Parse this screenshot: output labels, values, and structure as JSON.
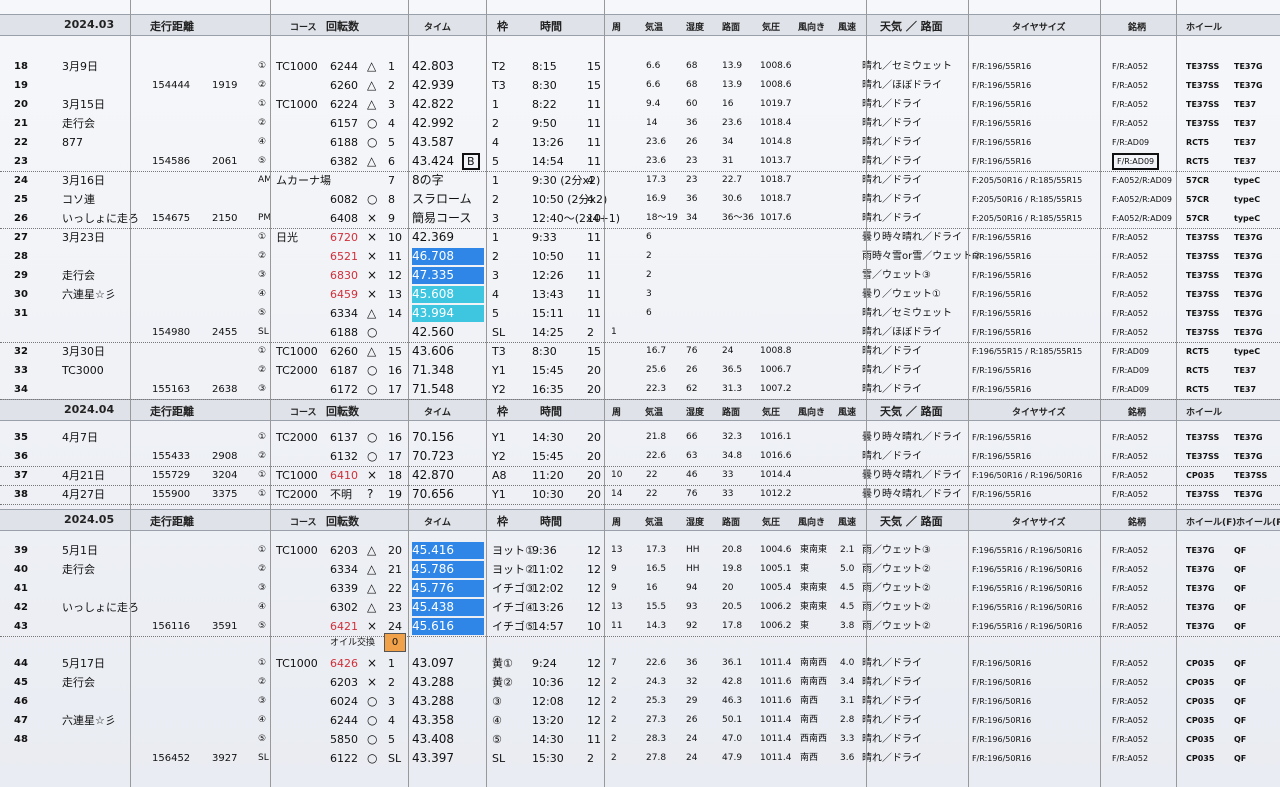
{
  "headers": [
    {
      "label": "2024.03",
      "km": "走行距離",
      "course": "コース",
      "rpm": "回転数",
      "time": "タイム",
      "frame": "枠",
      "hour": "時間",
      "lap": "周",
      "temp": "気温",
      "hum": "湿度",
      "road": "路面",
      "press": "気圧",
      "wdir": "風向き",
      "wspd": "風速",
      "weather": "天気 ／ 路面",
      "tire": "タイヤサイズ",
      "brand": "銘柄",
      "wheel": "ホイール",
      "wheel2": ""
    },
    {
      "label": "2024.04",
      "km": "走行距離",
      "course": "コース",
      "rpm": "回転数",
      "time": "タイム",
      "frame": "枠",
      "hour": "時間",
      "lap": "周",
      "temp": "気温",
      "hum": "湿度",
      "road": "路面",
      "press": "気圧",
      "wdir": "風向き",
      "wspd": "風速",
      "weather": "天気 ／ 路面",
      "tire": "タイヤサイズ",
      "brand": "銘柄",
      "wheel": "ホイール",
      "wheel2": ""
    },
    {
      "label": "2024.05",
      "km": "走行距離",
      "course": "コース",
      "rpm": "回転数",
      "time": "タイム",
      "frame": "枠",
      "hour": "時間",
      "lap": "周",
      "temp": "気温",
      "hum": "湿度",
      "road": "路面",
      "press": "気圧",
      "wdir": "風向き",
      "wspd": "風速",
      "weather": "天気 ／ 路面",
      "tire": "タイヤサイズ",
      "brand": "銘柄",
      "wheel": "ホイール(F)",
      "wheel2": "ホイール(R)"
    }
  ],
  "rows": [
    {
      "idx": "18",
      "date": "3月9日",
      "km": "",
      "d2": "",
      "n": "①",
      "cs": "TC1000",
      "rpm": "6244",
      "mk": "△",
      "lap": "1",
      "tm": "42.803",
      "fr": "T2",
      "hr": "8:15",
      "sh": "15",
      "lp": "",
      "tp": "6.6",
      "hm": "68",
      "rs": "13.9",
      "pr": "1008.6",
      "wd": "",
      "ws": "",
      "wx": "晴れ／セミウェット",
      "ty": "F/R:196/55R16",
      "br": "F/R:A052",
      "w1": "TE37SS",
      "w2": "TE37G"
    },
    {
      "idx": "19",
      "date": "",
      "km": "154444",
      "d2": "1919",
      "n": "②",
      "cs": "",
      "rpm": "6260",
      "mk": "△",
      "lap": "2",
      "tm": "42.939",
      "fr": "T3",
      "hr": "8:30",
      "sh": "15",
      "lp": "",
      "tp": "6.6",
      "hm": "68",
      "rs": "13.9",
      "pr": "1008.6",
      "wd": "",
      "ws": "",
      "wx": "晴れ／ほぼドライ",
      "ty": "F/R:196/55R16",
      "br": "F/R:A052",
      "w1": "TE37SS",
      "w2": "TE37G"
    },
    {
      "idx": "20",
      "date": "3月15日",
      "km": "",
      "d2": "",
      "n": "①",
      "cs": "TC1000",
      "rpm": "6224",
      "mk": "△",
      "lap": "3",
      "tm": "42.822",
      "fr": "1",
      "hr": "8:22",
      "sh": "11",
      "lp": "",
      "tp": "9.4",
      "hm": "60",
      "rs": "16",
      "pr": "1019.7",
      "wd": "",
      "ws": "",
      "wx": "晴れ／ドライ",
      "ty": "F/R:196/55R16",
      "br": "F/R:A052",
      "w1": "TE37SS",
      "w2": "TE37"
    },
    {
      "idx": "21",
      "date": "走行会",
      "km": "",
      "d2": "",
      "n": "②",
      "cs": "",
      "rpm": "6157",
      "mk": "○",
      "lap": "4",
      "tm": "42.992",
      "fr": "2",
      "hr": "9:50",
      "sh": "11",
      "lp": "",
      "tp": "14",
      "hm": "36",
      "rs": "23.6",
      "pr": "1018.4",
      "wd": "",
      "ws": "",
      "wx": "晴れ／ドライ",
      "ty": "F/R:196/55R16",
      "br": "F/R:A052",
      "w1": "TE37SS",
      "w2": "TE37"
    },
    {
      "idx": "22",
      "date": "877",
      "km": "",
      "d2": "",
      "n": "④",
      "cs": "",
      "rpm": "6188",
      "mk": "○",
      "lap": "5",
      "tm": "43.587",
      "fr": "4",
      "hr": "13:26",
      "sh": "11",
      "lp": "",
      "tp": "23.6",
      "hm": "26",
      "rs": "34",
      "pr": "1014.8",
      "wd": "",
      "ws": "",
      "wx": "晴れ／ドライ",
      "ty": "F/R:196/55R16",
      "br": "F/R:AD09",
      "w1": "RCT5",
      "w2": "TE37"
    },
    {
      "idx": "23",
      "date": "",
      "km": "154586",
      "d2": "2061",
      "n": "⑤",
      "cs": "",
      "rpm": "6382",
      "mk": "△",
      "lap": "6",
      "tm": "43.424",
      "fr": "5",
      "hr": "14:54",
      "sh": "11",
      "lp": "",
      "tp": "23.6",
      "hm": "23",
      "rs": "31",
      "pr": "1013.7",
      "wd": "",
      "ws": "",
      "wx": "晴れ／ドライ",
      "ty": "F/R:196/55R16",
      "br": "F/R:AD09",
      "w1": "RCT5",
      "w2": "TE37",
      "flagB": "B",
      "boxBrand": true
    },
    {
      "idx": "24",
      "date": "3月16日",
      "km": "",
      "d2": "",
      "n": "AM",
      "cs": "ムカーナ場",
      "rpm": "",
      "mk": "",
      "lap": "7",
      "tm": "8の字",
      "fr": "1",
      "hr": "9:30 (2分x2)",
      "sh": "4",
      "lp": "",
      "tp": "17.3",
      "hm": "23",
      "rs": "22.7",
      "pr": "1018.7",
      "wd": "",
      "ws": "",
      "wx": "晴れ／ドライ",
      "ty": "F:205/50R16 / R:185/55R15",
      "br": "F:A052/R:AD09",
      "w1": "57CR",
      "w2": "typeC"
    },
    {
      "idx": "25",
      "date": "コソ連",
      "km": "",
      "d2": "",
      "n": "",
      "cs": "",
      "rpm": "6082",
      "mk": "○",
      "lap": "8",
      "tm": "スラローム",
      "fr": "2",
      "hr": "10:50 (2分x2)",
      "sh": "4",
      "lp": "",
      "tp": "16.9",
      "hm": "36",
      "rs": "30.6",
      "pr": "1018.7",
      "wd": "",
      "ws": "",
      "wx": "晴れ／ドライ",
      "ty": "F:205/50R16 / R:185/55R15",
      "br": "F:A052/R:AD09",
      "w1": "57CR",
      "w2": "typeC"
    },
    {
      "idx": "26",
      "date": "いっしょに走ろ",
      "km": "154675",
      "d2": "2150",
      "n": "PM",
      "cs": "",
      "rpm": "6408",
      "mk": "×",
      "lap": "9",
      "tm": "簡易コース",
      "fr": "3",
      "hr": "12:40〜(2x4+1)",
      "sh": "10",
      "lp": "",
      "tp": "18〜19",
      "hm": "34",
      "rs": "36〜36",
      "pr": "1017.6",
      "wd": "",
      "ws": "",
      "wx": "晴れ／ドライ",
      "ty": "F:205/50R16 / R:185/55R15",
      "br": "F:A052/R:AD09",
      "w1": "57CR",
      "w2": "typeC"
    },
    {
      "idx": "27",
      "date": "3月23日",
      "km": "",
      "d2": "",
      "n": "①",
      "cs": "日光",
      "rpm": "6720",
      "red": true,
      "mk": "×",
      "lap": "10",
      "tm": "42.369",
      "fr": "1",
      "hr": "9:33",
      "sh": "11",
      "lp": "",
      "tp": "6",
      "hm": "",
      "rs": "",
      "pr": "",
      "wd": "",
      "ws": "",
      "wx": "曇り時々晴れ／ドライ",
      "ty": "F/R:196/55R16",
      "br": "F/R:A052",
      "w1": "TE37SS",
      "w2": "TE37G"
    },
    {
      "idx": "28",
      "date": "",
      "km": "",
      "d2": "",
      "n": "②",
      "cs": "",
      "rpm": "6521",
      "red": true,
      "mk": "×",
      "lap": "11",
      "tm": "46.708",
      "tmc": "blue",
      "fr": "2",
      "hr": "10:50",
      "sh": "11",
      "lp": "",
      "tp": "2",
      "hm": "",
      "rs": "",
      "pr": "",
      "wd": "",
      "ws": "",
      "wx": "雨時々雪or雪／ウェット②",
      "ty": "F/R:196/55R16",
      "br": "F/R:A052",
      "w1": "TE37SS",
      "w2": "TE37G"
    },
    {
      "idx": "29",
      "date": "走行会",
      "km": "",
      "d2": "",
      "n": "③",
      "cs": "",
      "rpm": "6830",
      "red": true,
      "mk": "×",
      "lap": "12",
      "tm": "47.335",
      "tmc": "blue",
      "fr": "3",
      "hr": "12:26",
      "sh": "11",
      "lp": "",
      "tp": "2",
      "hm": "",
      "rs": "",
      "pr": "",
      "wd": "",
      "ws": "",
      "wx": "雪／ウェット③",
      "ty": "F/R:196/55R16",
      "br": "F/R:A052",
      "w1": "TE37SS",
      "w2": "TE37G"
    },
    {
      "idx": "30",
      "date": "六連星☆彡",
      "km": "",
      "d2": "",
      "n": "④",
      "cs": "",
      "rpm": "6459",
      "red": true,
      "mk": "×",
      "lap": "13",
      "tm": "45.608",
      "tmc": "cyan",
      "fr": "4",
      "hr": "13:43",
      "sh": "11",
      "lp": "",
      "tp": "3",
      "hm": "",
      "rs": "",
      "pr": "",
      "wd": "",
      "ws": "",
      "wx": "曇り／ウェット①",
      "ty": "F/R:196/55R16",
      "br": "F/R:A052",
      "w1": "TE37SS",
      "w2": "TE37G"
    },
    {
      "idx": "31",
      "date": "",
      "km": "",
      "d2": "",
      "n": "⑤",
      "cs": "",
      "rpm": "6334",
      "mk": "△",
      "lap": "14",
      "tm": "43.994",
      "tmc": "cyan",
      "fr": "5",
      "hr": "15:11",
      "sh": "11",
      "lp": "",
      "tp": "6",
      "hm": "",
      "rs": "",
      "pr": "",
      "wd": "",
      "ws": "",
      "wx": "晴れ／セミウェット",
      "ty": "F/R:196/55R16",
      "br": "F/R:A052",
      "w1": "TE37SS",
      "w2": "TE37G"
    },
    {
      "idx": "",
      "date": "",
      "km": "154980",
      "d2": "2455",
      "n": "SL",
      "cs": "",
      "rpm": "6188",
      "mk": "○",
      "lap": "",
      "tm": "42.560",
      "fr": "SL",
      "hr": "14:25",
      "sh": "2",
      "lp": "1",
      "tp": "",
      "hm": "",
      "rs": "",
      "pr": "",
      "wd": "",
      "ws": "",
      "wx": "晴れ／ほぼドライ",
      "ty": "F/R:196/55R16",
      "br": "F/R:A052",
      "w1": "TE37SS",
      "w2": "TE37G"
    },
    {
      "idx": "32",
      "date": "3月30日",
      "km": "",
      "d2": "",
      "n": "①",
      "cs": "TC1000",
      "rpm": "6260",
      "mk": "△",
      "lap": "15",
      "tm": "43.606",
      "fr": "T3",
      "hr": "8:30",
      "sh": "15",
      "lp": "",
      "tp": "16.7",
      "hm": "76",
      "rs": "24",
      "pr": "1008.8",
      "wd": "",
      "ws": "",
      "wx": "晴れ／ドライ",
      "ty": "F:196/55R15 / R:185/55R15",
      "br": "F/R:AD09",
      "w1": "RCT5",
      "w2": "typeC"
    },
    {
      "idx": "33",
      "date": "TC3000",
      "km": "",
      "d2": "",
      "n": "②",
      "cs": "TC2000",
      "rpm": "6187",
      "mk": "○",
      "lap": "16",
      "tm": "71.348",
      "fr": "Y1",
      "hr": "15:45",
      "sh": "20",
      "lp": "",
      "tp": "25.6",
      "hm": "26",
      "rs": "36.5",
      "pr": "1006.7",
      "wd": "",
      "ws": "",
      "wx": "晴れ／ドライ",
      "ty": "F/R:196/55R16",
      "br": "F/R:AD09",
      "w1": "RCT5",
      "w2": "TE37"
    },
    {
      "idx": "34",
      "date": "",
      "km": "155163",
      "d2": "2638",
      "n": "③",
      "cs": "",
      "rpm": "6172",
      "mk": "○",
      "lap": "17",
      "tm": "71.548",
      "fr": "Y2",
      "hr": "16:35",
      "sh": "20",
      "lp": "",
      "tp": "22.3",
      "hm": "62",
      "rs": "31.3",
      "pr": "1007.2",
      "wd": "",
      "ws": "",
      "wx": "晴れ／ドライ",
      "ty": "F/R:196/55R16",
      "br": "F/R:AD09",
      "w1": "RCT5",
      "w2": "TE37"
    },
    {
      "idx": "35",
      "date": "4月7日",
      "km": "",
      "d2": "",
      "n": "①",
      "cs": "TC2000",
      "rpm": "6137",
      "mk": "○",
      "lap": "16",
      "tm": "70.156",
      "fr": "Y1",
      "hr": "14:30",
      "sh": "20",
      "lp": "",
      "tp": "21.8",
      "hm": "66",
      "rs": "32.3",
      "pr": "1016.1",
      "wd": "",
      "ws": "",
      "wx": "曇り時々晴れ／ドライ",
      "ty": "F/R:196/55R16",
      "br": "F/R:A052",
      "w1": "TE37SS",
      "w2": "TE37G"
    },
    {
      "idx": "36",
      "date": "",
      "km": "155433",
      "d2": "2908",
      "n": "②",
      "cs": "",
      "rpm": "6132",
      "mk": "○",
      "lap": "17",
      "tm": "70.723",
      "fr": "Y2",
      "hr": "15:45",
      "sh": "20",
      "lp": "",
      "tp": "22.6",
      "hm": "63",
      "rs": "34.8",
      "pr": "1016.6",
      "wd": "",
      "ws": "",
      "wx": "晴れ／ドライ",
      "ty": "F/R:196/55R16",
      "br": "F/R:A052",
      "w1": "TE37SS",
      "w2": "TE37G"
    },
    {
      "idx": "37",
      "date": "4月21日",
      "km": "155729",
      "d2": "3204",
      "n": "①",
      "cs": "TC1000",
      "rpm": "6410",
      "red": true,
      "mk": "×",
      "lap": "18",
      "tm": "42.870",
      "fr": "A8",
      "hr": "11:20",
      "sh": "20",
      "lp": "10",
      "tp": "22",
      "hm": "46",
      "rs": "33",
      "pr": "1014.4",
      "wd": "",
      "ws": "",
      "wx": "曇り時々晴れ／ドライ",
      "ty": "F:196/50R16 / R:196/50R16",
      "br": "F/R:A052",
      "w1": "CP035",
      "w2": "TE37SS"
    },
    {
      "idx": "38",
      "date": "4月27日",
      "km": "155900",
      "d2": "3375",
      "n": "①",
      "cs": "TC2000",
      "rpm": "不明",
      "mk": "?",
      "lap": "19",
      "tm": "70.656",
      "fr": "Y1",
      "hr": "10:30",
      "sh": "20",
      "lp": "14",
      "tp": "22",
      "hm": "76",
      "rs": "33",
      "pr": "1012.2",
      "wd": "",
      "ws": "",
      "wx": "曇り時々晴れ／ドライ",
      "ty": "F/R:196/55R16",
      "br": "F/R:A052",
      "w1": "TE37SS",
      "w2": "TE37G"
    },
    {
      "idx": "39",
      "date": "5月1日",
      "km": "",
      "d2": "",
      "n": "①",
      "cs": "TC1000",
      "rpm": "6203",
      "mk": "△",
      "lap": "20",
      "tm": "45.416",
      "tmc": "blue",
      "fr": "ヨット①",
      "hr": "9:36",
      "sh": "12",
      "lp": "13",
      "tp": "17.3",
      "hm": "HH",
      "rs": "20.8",
      "pr": "1004.6",
      "wd": "東南東",
      "ws": "2.1",
      "wx": "雨／ウェット③",
      "ty": "F:196/55R16 / R:196/50R16",
      "br": "F/R:A052",
      "w1": "TE37G",
      "w2": "QF"
    },
    {
      "idx": "40",
      "date": "走行会",
      "km": "",
      "d2": "",
      "n": "②",
      "cs": "",
      "rpm": "6334",
      "mk": "△",
      "lap": "21",
      "tm": "45.786",
      "tmc": "blue",
      "fr": "ヨット②",
      "hr": "11:02",
      "sh": "12",
      "lp": "9",
      "tp": "16.5",
      "hm": "HH",
      "rs": "19.8",
      "pr": "1005.1",
      "wd": "東",
      "ws": "5.0",
      "wx": "雨／ウェット②",
      "ty": "F:196/55R16 / R:196/50R16",
      "br": "F/R:A052",
      "w1": "TE37G",
      "w2": "QF"
    },
    {
      "idx": "41",
      "date": "",
      "km": "",
      "d2": "",
      "n": "③",
      "cs": "",
      "rpm": "6339",
      "mk": "△",
      "lap": "22",
      "tm": "45.776",
      "tmc": "blue",
      "fr": "イチゴ③",
      "hr": "12:02",
      "sh": "12",
      "lp": "9",
      "tp": "16",
      "hm": "94",
      "rs": "20",
      "pr": "1005.4",
      "wd": "東南東",
      "ws": "4.5",
      "wx": "雨／ウェット②",
      "ty": "F:196/55R16 / R:196/50R16",
      "br": "F/R:A052",
      "w1": "TE37G",
      "w2": "QF"
    },
    {
      "idx": "42",
      "date": "いっしょに走ろ",
      "km": "",
      "d2": "",
      "n": "④",
      "cs": "",
      "rpm": "6302",
      "mk": "△",
      "lap": "23",
      "tm": "45.438",
      "tmc": "blue",
      "fr": "イチゴ④",
      "hr": "13:26",
      "sh": "12",
      "lp": "13",
      "tp": "15.5",
      "hm": "93",
      "rs": "20.5",
      "pr": "1006.2",
      "wd": "東南東",
      "ws": "4.5",
      "wx": "雨／ウェット②",
      "ty": "F:196/55R16 / R:196/50R16",
      "br": "F/R:A052",
      "w1": "TE37G",
      "w2": "QF"
    },
    {
      "idx": "43",
      "date": "",
      "km": "156116",
      "d2": "3591",
      "n": "⑤",
      "cs": "",
      "rpm": "6421",
      "red": true,
      "mk": "×",
      "lap": "24",
      "tm": "45.616",
      "tmc": "blue",
      "fr": "イチゴ⑤",
      "hr": "14:57",
      "sh": "10",
      "lp": "11",
      "tp": "14.3",
      "hm": "92",
      "rs": "17.8",
      "pr": "1006.2",
      "wd": "東",
      "ws": "3.8",
      "wx": "雨／ウェット②",
      "ty": "F:196/55R16 / R:196/50R16",
      "br": "F/R:A052",
      "w1": "TE37G",
      "w2": "QF"
    },
    {
      "idx": "44",
      "date": "5月17日",
      "km": "",
      "d2": "",
      "n": "①",
      "cs": "TC1000",
      "rpm": "6426",
      "red": true,
      "mk": "×",
      "lap": "1",
      "tm": "43.097",
      "fr": "黄①",
      "hr": "9:24",
      "sh": "12",
      "lp": "7",
      "tp": "22.6",
      "hm": "36",
      "rs": "36.1",
      "pr": "1011.4",
      "wd": "南南西",
      "ws": "4.0",
      "wx": "晴れ／ドライ",
      "ty": "F/R:196/50R16",
      "br": "F/R:A052",
      "w1": "CP035",
      "w2": "QF"
    },
    {
      "idx": "45",
      "date": "走行会",
      "km": "",
      "d2": "",
      "n": "②",
      "cs": "",
      "rpm": "6203",
      "mk": "×",
      "lap": "2",
      "tm": "43.288",
      "fr": "黄②",
      "hr": "10:36",
      "sh": "12",
      "lp": "2",
      "tp": "24.3",
      "hm": "32",
      "rs": "42.8",
      "pr": "1011.6",
      "wd": "南南西",
      "ws": "3.4",
      "wx": "晴れ／ドライ",
      "ty": "F/R:196/50R16",
      "br": "F/R:A052",
      "w1": "CP035",
      "w2": "QF"
    },
    {
      "idx": "46",
      "date": "",
      "km": "",
      "d2": "",
      "n": "③",
      "cs": "",
      "rpm": "6024",
      "mk": "○",
      "lap": "3",
      "tm": "43.288",
      "fr": "③",
      "hr": "12:08",
      "sh": "12",
      "lp": "2",
      "tp": "25.3",
      "hm": "29",
      "rs": "46.3",
      "pr": "1011.6",
      "wd": "南西",
      "ws": "3.1",
      "wx": "晴れ／ドライ",
      "ty": "F/R:196/50R16",
      "br": "F/R:A052",
      "w1": "CP035",
      "w2": "QF"
    },
    {
      "idx": "47",
      "date": "六連星☆彡",
      "km": "",
      "d2": "",
      "n": "④",
      "cs": "",
      "rpm": "6244",
      "mk": "○",
      "lap": "4",
      "tm": "43.358",
      "fr": "④",
      "hr": "13:20",
      "sh": "12",
      "lp": "2",
      "tp": "27.3",
      "hm": "26",
      "rs": "50.1",
      "pr": "1011.4",
      "wd": "南西",
      "ws": "2.8",
      "wx": "晴れ／ドライ",
      "ty": "F/R:196/50R16",
      "br": "F/R:A052",
      "w1": "CP035",
      "w2": "QF"
    },
    {
      "idx": "48",
      "date": "",
      "km": "",
      "d2": "",
      "n": "⑤",
      "cs": "",
      "rpm": "5850",
      "mk": "○",
      "lap": "5",
      "tm": "43.408",
      "fr": "⑤",
      "hr": "14:30",
      "sh": "11",
      "lp": "2",
      "tp": "28.3",
      "hm": "24",
      "rs": "47.0",
      "pr": "1011.4",
      "wd": "西南西",
      "ws": "3.3",
      "wx": "晴れ／ドライ",
      "ty": "F/R:196/50R16",
      "br": "F/R:A052",
      "w1": "CP035",
      "w2": "QF"
    },
    {
      "idx": "",
      "date": "",
      "km": "156452",
      "d2": "3927",
      "n": "SL",
      "cs": "",
      "rpm": "6122",
      "mk": "○",
      "lap": "SL",
      "tm": "43.397",
      "fr": "SL",
      "hr": "15:30",
      "sh": "2",
      "lp": "2",
      "tp": "27.8",
      "hm": "24",
      "rs": "47.9",
      "pr": "1011.4",
      "wd": "南西",
      "ws": "3.6",
      "wx": "晴れ／ドライ",
      "ty": "F/R:196/50R16",
      "br": "F/R:A052",
      "w1": "CP035",
      "w2": "QF"
    }
  ],
  "oil": {
    "label": "オイル交換",
    "value": "0"
  }
}
